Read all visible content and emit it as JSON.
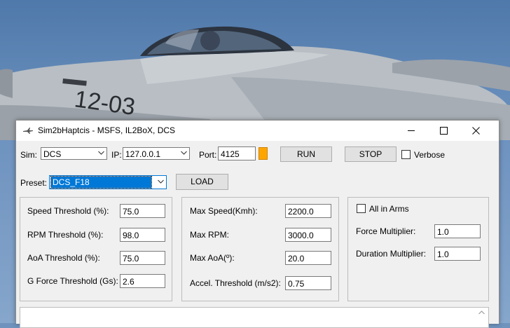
{
  "window": {
    "title": "Sim2bHaptcis - MSFS, IL2BoX, DCS",
    "minimize_icon": "minimize-icon",
    "maximize_icon": "maximize-icon",
    "close_icon": "close-icon"
  },
  "toolbar": {
    "sim_label": "Sim:",
    "sim_value": "DCS",
    "ip_label": "IP:",
    "ip_value": "127.0.0.1",
    "port_label": "Port:",
    "port_value": "4125",
    "status_color": "#FFA500",
    "run_label": "RUN",
    "stop_label": "STOP",
    "verbose_label": "Verbose",
    "verbose_checked": false
  },
  "preset": {
    "label": "Preset:",
    "value": "DCS_F18",
    "load_label": "LOAD"
  },
  "thresholds": {
    "speed_label": "Speed Threshold (%):",
    "speed_value": "75.0",
    "rpm_label": "RPM Threshold (%):",
    "rpm_value": "98.0",
    "aoa_label": "AoA Threshold (%):",
    "aoa_value": "75.0",
    "gforce_label": "G Force Threshold (Gs):",
    "gforce_value": "2.6"
  },
  "maxima": {
    "max_speed_label": "Max Speed(Kmh):",
    "max_speed_value": "2200.0",
    "max_rpm_label": "Max RPM:",
    "max_rpm_value": "3000.0",
    "max_aoa_label": "Max AoA(º):",
    "max_aoa_value": "20.0",
    "accel_label": "Accel. Threshold (m/s2):",
    "accel_value": "0.75"
  },
  "multipliers": {
    "all_in_arms_label": "All in Arms",
    "all_in_arms_checked": false,
    "force_label": "Force Multiplier:",
    "force_value": "1.0",
    "duration_label": "Duration Multiplier:",
    "duration_value": "1.0"
  },
  "output": {
    "text": ""
  }
}
